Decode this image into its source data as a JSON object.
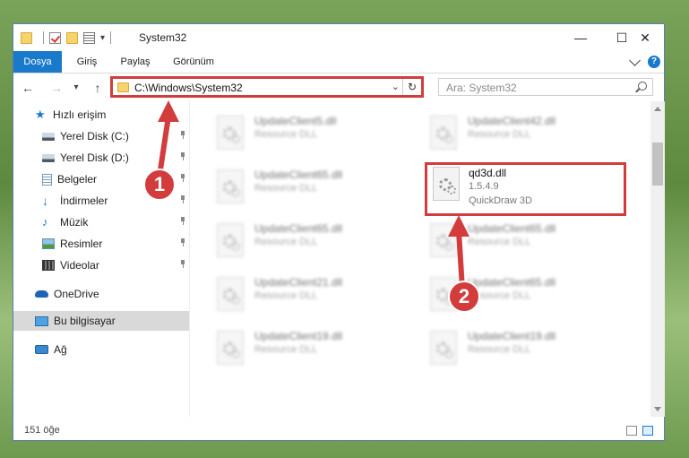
{
  "window": {
    "title": "System32",
    "controls": {
      "minimize": "—",
      "maximize": "☐",
      "close": "✕"
    }
  },
  "quick_access_toolbar": {
    "dropdown": "▾"
  },
  "ribbon": {
    "tabs": [
      {
        "label": "Dosya",
        "active": true
      },
      {
        "label": "Giriş"
      },
      {
        "label": "Paylaş"
      },
      {
        "label": "Görünüm"
      }
    ],
    "help": "?"
  },
  "nav": {
    "back": "←",
    "forward": "→",
    "recent": "▾",
    "up": "↑",
    "address": "C:\\Windows\\System32",
    "address_dropdown": "⌄",
    "refresh": "↻",
    "search_placeholder": "Ara: System32"
  },
  "sidebar": {
    "items": [
      {
        "label": "Hızlı erişim",
        "icon": "star-icon",
        "pinned": false,
        "selected": false
      },
      {
        "label": "Yerel Disk (C:)",
        "icon": "drive-icon",
        "pinned": true,
        "selected": false
      },
      {
        "label": "Yerel Disk (D:)",
        "icon": "drive-icon",
        "pinned": true,
        "selected": false
      },
      {
        "label": "Belgeler",
        "icon": "documents-icon",
        "pinned": true,
        "selected": false
      },
      {
        "label": "İndirmeler",
        "icon": "download-icon",
        "pinned": true,
        "selected": false
      },
      {
        "label": "Müzik",
        "icon": "music-icon",
        "pinned": true,
        "selected": false
      },
      {
        "label": "Resimler",
        "icon": "pictures-icon",
        "pinned": true,
        "selected": false
      },
      {
        "label": "Videolar",
        "icon": "videos-icon",
        "pinned": true,
        "selected": false
      },
      {
        "label": "OneDrive",
        "icon": "cloud-icon",
        "pinned": false,
        "selected": false
      },
      {
        "label": "Bu bilgisayar",
        "icon": "computer-icon",
        "pinned": false,
        "selected": true
      },
      {
        "label": "Ağ",
        "icon": "network-icon",
        "pinned": false,
        "selected": false
      }
    ]
  },
  "files": [
    {
      "name": "UpdateClient5.dll",
      "desc": "Resource DLL",
      "blurred": true
    },
    {
      "name": "UpdateClient42.dll",
      "desc": "Resource DLL",
      "blurred": true
    },
    {
      "name": "UpdateClient65.dll",
      "desc": "Resource DLL",
      "blurred": true
    },
    {
      "name": "qd3d.dll",
      "version": "1.5.4.9",
      "desc": "QuickDraw 3D",
      "blurred": false,
      "highlighted": true
    },
    {
      "name": "UpdateClient65.dll",
      "desc": "Resource DLL",
      "blurred": true
    },
    {
      "name": "UpdateClient65.dll",
      "desc": "Resource DLL",
      "blurred": true
    },
    {
      "name": "UpdateClient21.dll",
      "desc": "Resource DLL",
      "blurred": true
    },
    {
      "name": "UpdateClient65.dll",
      "desc": "Resource DLL",
      "blurred": true
    },
    {
      "name": "UpdateClient19.dll",
      "desc": "Resource DLL",
      "blurred": true
    },
    {
      "name": "UpdateClient19.dll",
      "desc": "Resource DLL",
      "blurred": true
    }
  ],
  "status": {
    "count": "151 öğe"
  },
  "callouts": [
    "1",
    "2"
  ],
  "colors": {
    "accent": "#1979ca",
    "highlight": "#d23c3c"
  }
}
